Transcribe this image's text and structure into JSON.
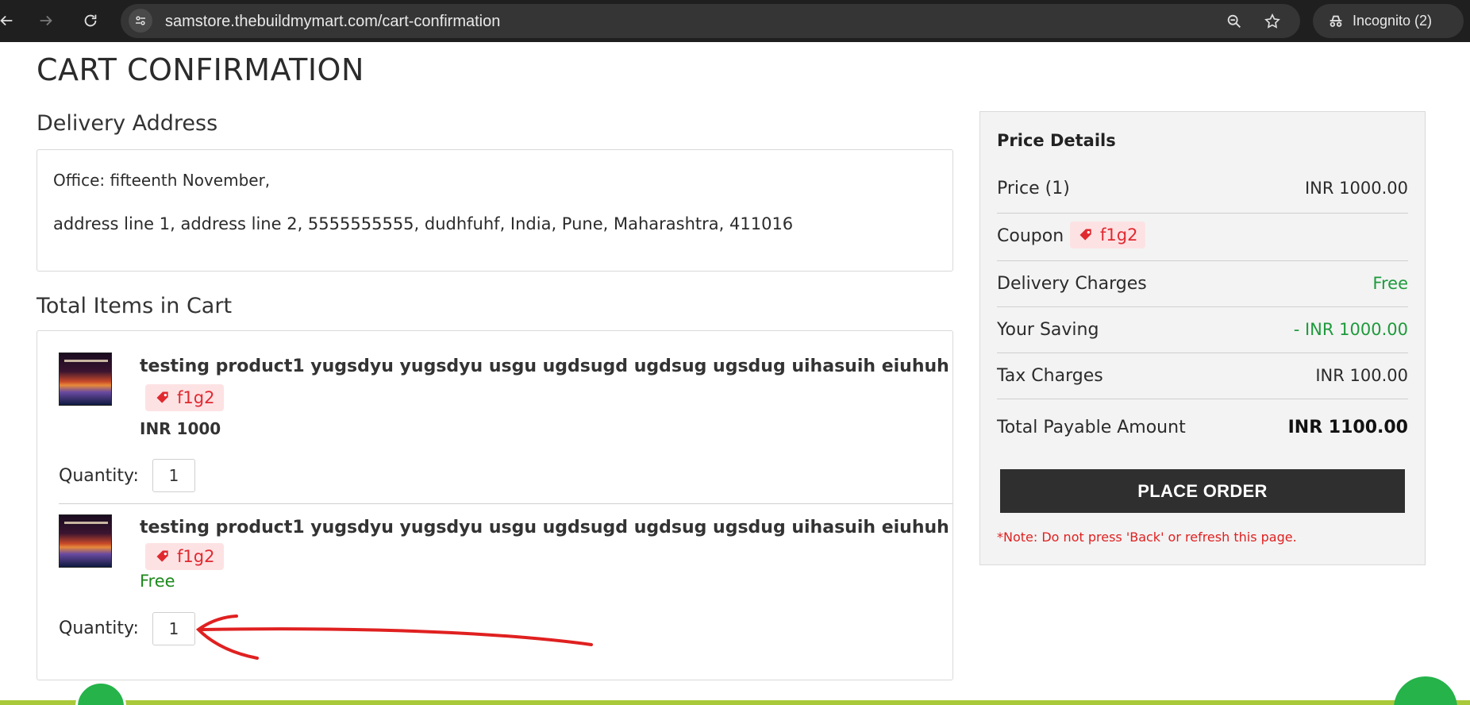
{
  "browser": {
    "url": "samstore.thebuildmymart.com/cart-confirmation",
    "incognito_label": "Incognito (2)"
  },
  "page": {
    "title": "CART CONFIRMATION"
  },
  "delivery": {
    "section_title": "Delivery Address",
    "line1": "Office: fifteenth November,",
    "line2": "address line 1, address line 2, 5555555555, dudhfuhf, India, Pune, Maharashtra, 411016"
  },
  "cart": {
    "section_title": "Total Items in Cart",
    "quantity_label": "Quantity:",
    "items": [
      {
        "name": "testing product1 yugsdyu yugsdyu usgu ugdsugd ugdsug ugsdug uihasuih eiuhuh",
        "coupon": "f1g2",
        "price": "INR 1000",
        "quantity": "1"
      },
      {
        "name": "testing product1 yugsdyu yugsdyu usgu ugdsugd ugdsug ugsdug uihasuih eiuhuh",
        "coupon": "f1g2",
        "price": "Free",
        "quantity": "1"
      }
    ]
  },
  "price_details": {
    "title": "Price Details",
    "price_label": "Price  (1)",
    "price_value": "INR  1000.00",
    "coupon_label": "Coupon",
    "coupon_code": "f1g2",
    "delivery_label": "Delivery Charges",
    "delivery_value": "Free",
    "saving_label": "Your Saving",
    "saving_value": "- INR  1000.00",
    "tax_label": "Tax Charges",
    "tax_value": "INR  100.00",
    "total_label": "Total Payable Amount",
    "total_value": "INR  1100.00",
    "place_order": "PLACE ORDER",
    "note": "*Note: Do not press 'Back' or refresh this page."
  },
  "colors": {
    "coupon_red": "#e0292f",
    "coupon_bg": "#fde2e4",
    "free_green": "#1e9a3c",
    "button_dark": "#2f2f2f",
    "annotation_red": "#e02020"
  }
}
